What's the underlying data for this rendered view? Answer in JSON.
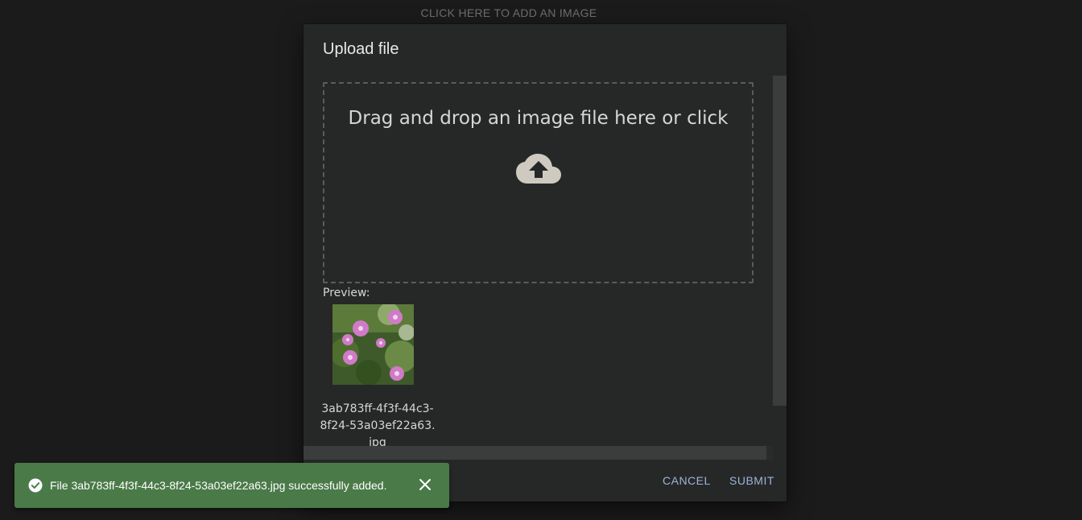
{
  "page": {
    "add_image_label": "CLICK HERE TO ADD AN IMAGE"
  },
  "dialog": {
    "title": "Upload file",
    "dropzone_text": "Drag and drop an image file here or click",
    "dropzone_icon": "cloud-upload-icon",
    "preview_label": "Preview:",
    "preview": {
      "filename": "3ab783ff-4f3f-44c3-8f24-53a03ef22a63.jpg",
      "image_description_icon": "flower-photo-thumbnail"
    },
    "actions": {
      "cancel_label": "CANCEL",
      "submit_label": "SUBMIT"
    }
  },
  "snackbar": {
    "icon": "check-circle-icon",
    "message": "File 3ab783ff-4f3f-44c3-8f24-53a03ef22a63.jpg successfully added.",
    "close_icon": "close-icon"
  },
  "colors": {
    "background": "#1b1b1b",
    "dialog_bg": "#262828",
    "accent_button": "#9fb4d8",
    "snackbar_success": "#4a7a48"
  }
}
